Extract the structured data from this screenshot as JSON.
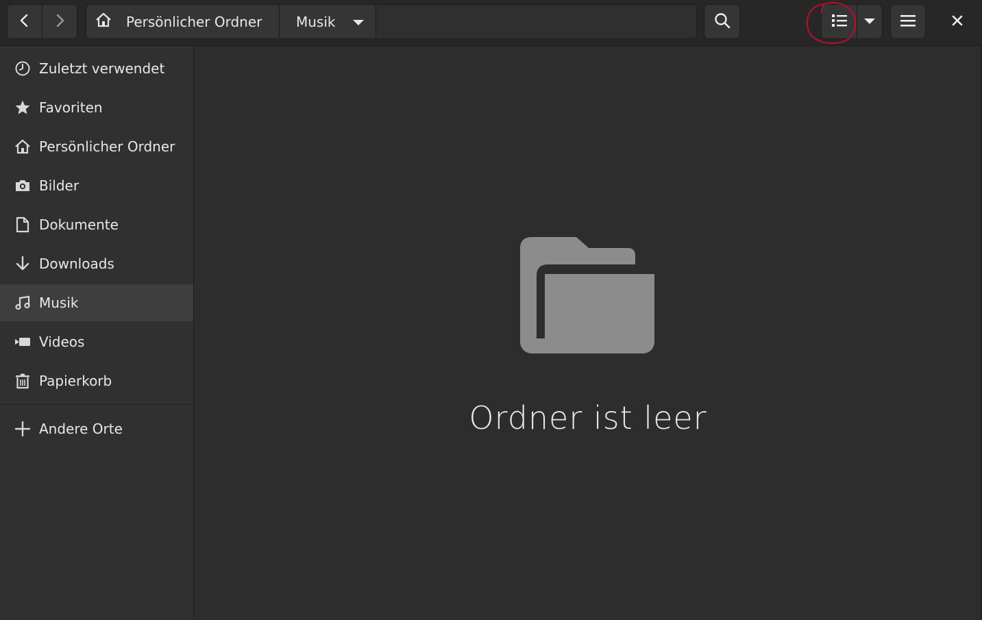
{
  "toolbar": {
    "back_icon": "go-back-icon",
    "forward_icon": "go-forward-icon",
    "search_icon": "search-icon",
    "view_icon": "list-view-icon",
    "view_menu_icon": "chevron-down-icon",
    "menu_icon": "hamburger-menu-icon",
    "close_icon": "close-icon"
  },
  "pathbar": {
    "crumbs": [
      {
        "label": "Persönlicher Ordner",
        "icon": "home-icon"
      },
      {
        "label": "Musik",
        "icon": "chevron-down-icon"
      }
    ]
  },
  "sidebar": {
    "items": [
      {
        "label": "Zuletzt verwendet",
        "icon": "clock-icon"
      },
      {
        "label": "Favoriten",
        "icon": "star-icon"
      },
      {
        "label": "Persönlicher Ordner",
        "icon": "home-icon"
      },
      {
        "label": "Bilder",
        "icon": "camera-icon"
      },
      {
        "label": "Dokumente",
        "icon": "document-icon"
      },
      {
        "label": "Downloads",
        "icon": "download-icon"
      },
      {
        "label": "Musik",
        "icon": "music-icon",
        "selected": true
      },
      {
        "label": "Videos",
        "icon": "video-icon"
      },
      {
        "label": "Papierkorb",
        "icon": "trash-icon"
      }
    ],
    "other_places": {
      "label": "Andere Orte",
      "icon": "plus-icon"
    }
  },
  "main": {
    "empty_icon": "folder-icon",
    "empty_message": "Ordner ist leer"
  },
  "colors": {
    "background": "#2d2d2d",
    "sidebar": "#303030",
    "selected": "#3e3e3e",
    "annotation": "#b0102a"
  }
}
